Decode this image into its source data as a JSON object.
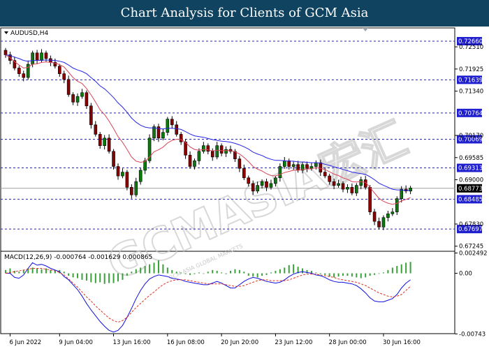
{
  "banner": {
    "title": "Chart Analysis for Clients of GCM Asia"
  },
  "watermark": {
    "text": "GCMASIA宏汇",
    "subtext": "GCM ASIA GLOBAL MARKETS"
  },
  "chart_data": [
    {
      "type": "candlestick",
      "symbol_label": "AUDUSD,H4",
      "ylim": [
        0.6711,
        0.7301
      ],
      "y_ticks": [
        "0.72510",
        "0.71925",
        "0.71340",
        "0.70170",
        "0.69585",
        "0.69000",
        "0.67830",
        "0.67245"
      ],
      "x_ticks": [
        "6 Jun 2022",
        "9 Jun 04:00",
        "13 Jun 16:00",
        "16 Jun 08:00",
        "20 Jun 20:00",
        "23 Jun 12:00",
        "28 Jun 00:00",
        "30 Jun 16:00"
      ],
      "levels": [
        {
          "value": 0.7266,
          "label": "0.72660"
        },
        {
          "value": 0.71639,
          "label": "0.71639"
        },
        {
          "value": 0.70764,
          "label": "0.70764"
        },
        {
          "value": 0.70069,
          "label": "0.70069"
        },
        {
          "value": 0.69313,
          "label": "0.69313"
        },
        {
          "value": 0.68485,
          "label": "0.68485"
        },
        {
          "value": 0.67697,
          "label": "0.67697"
        }
      ],
      "current_price": {
        "value": 0.68773,
        "label": "0.68773"
      },
      "closes": [
        0.723,
        0.7215,
        0.7195,
        0.718,
        0.717,
        0.7205,
        0.7235,
        0.7215,
        0.7235,
        0.722,
        0.721,
        0.72,
        0.718,
        0.7165,
        0.7125,
        0.7105,
        0.712,
        0.713,
        0.7095,
        0.7045,
        0.702,
        0.699,
        0.701,
        0.6975,
        0.6935,
        0.691,
        0.692,
        0.688,
        0.686,
        0.6895,
        0.6925,
        0.695,
        0.701,
        0.704,
        0.701,
        0.7025,
        0.706,
        0.7045,
        0.702,
        0.7,
        0.6965,
        0.6935,
        0.695,
        0.6975,
        0.699,
        0.6975,
        0.696,
        0.699,
        0.697,
        0.698,
        0.6975,
        0.6955,
        0.693,
        0.6905,
        0.689,
        0.687,
        0.6885,
        0.6895,
        0.688,
        0.689,
        0.6905,
        0.6935,
        0.695,
        0.6935,
        0.694,
        0.6925,
        0.694,
        0.693,
        0.6935,
        0.6945,
        0.692,
        0.691,
        0.6895,
        0.6885,
        0.689,
        0.6875,
        0.688,
        0.6865,
        0.6885,
        0.69,
        0.688,
        0.6815,
        0.679,
        0.6775,
        0.68,
        0.681,
        0.6815,
        0.685,
        0.6875,
        0.687,
        0.6878
      ],
      "ema_fast": [
        0.723,
        0.7222,
        0.7212,
        0.7203,
        0.7195,
        0.7197,
        0.7205,
        0.7206,
        0.721,
        0.7211,
        0.721,
        0.7208,
        0.7204,
        0.7198,
        0.7184,
        0.717,
        0.716,
        0.7154,
        0.7141,
        0.7124,
        0.7105,
        0.7085,
        0.7072,
        0.7055,
        0.7035,
        0.7014,
        0.6999,
        0.698,
        0.696,
        0.6949,
        0.6946,
        0.6948,
        0.696,
        0.6974,
        0.6979,
        0.6986,
        0.6997,
        0.7004,
        0.7007,
        0.7006,
        0.6999,
        0.6987,
        0.698,
        0.6978,
        0.698,
        0.6979,
        0.6976,
        0.6978,
        0.6977,
        0.6977,
        0.6977,
        0.6974,
        0.6968,
        0.6959,
        0.6948,
        0.6935,
        0.6928,
        0.6923,
        0.6916,
        0.6911,
        0.691,
        0.6914,
        0.6919,
        0.6922,
        0.6925,
        0.6925,
        0.6927,
        0.6928,
        0.6929,
        0.6932,
        0.693,
        0.6927,
        0.6921,
        0.6915,
        0.6911,
        0.6905,
        0.6901,
        0.6895,
        0.6894,
        0.6895,
        0.6893,
        0.688,
        0.6865,
        0.6851,
        0.6843,
        0.6838,
        0.6835,
        0.6838,
        0.6844,
        0.6848,
        0.6853
      ],
      "ema_slow": [
        0.723,
        0.7228,
        0.7224,
        0.722,
        0.7215,
        0.7213,
        0.7215,
        0.7215,
        0.7216,
        0.7216,
        0.7216,
        0.7215,
        0.7213,
        0.721,
        0.7203,
        0.7195,
        0.719,
        0.7186,
        0.718,
        0.717,
        0.716,
        0.7148,
        0.714,
        0.7129,
        0.7117,
        0.7103,
        0.7092,
        0.7078,
        0.7063,
        0.7052,
        0.7044,
        0.7039,
        0.7037,
        0.7037,
        0.7035,
        0.7034,
        0.7036,
        0.7036,
        0.7035,
        0.7033,
        0.7027,
        0.7021,
        0.7016,
        0.7014,
        0.7012,
        0.7009,
        0.7006,
        0.7004,
        0.7002,
        0.7001,
        0.6999,
        0.6996,
        0.6992,
        0.6987,
        0.6981,
        0.6973,
        0.6968,
        0.6964,
        0.6958,
        0.6954,
        0.6951,
        0.6951,
        0.695,
        0.6949,
        0.6949,
        0.6947,
        0.6947,
        0.6946,
        0.6945,
        0.6945,
        0.6944,
        0.6941,
        0.6938,
        0.6934,
        0.6931,
        0.6927,
        0.6924,
        0.692,
        0.6918,
        0.6916,
        0.6914,
        0.6908,
        0.69,
        0.6891,
        0.6885,
        0.688,
        0.6875,
        0.6873,
        0.6873,
        0.6872,
        0.6872
      ]
    },
    {
      "type": "macd",
      "label": "MACD(12,26,9) -0.000764 -0.001629 0.000865",
      "ylim": [
        -0.0074,
        0.0027
      ],
      "y_ticks": [
        {
          "value": 0.002492,
          "label": "0.002492"
        },
        {
          "value": 0.0,
          "label": "0.00"
        },
        {
          "value": -0.00743,
          "label": "-0.00743"
        }
      ],
      "macd": [
        0.0,
        0.0,
        -0.0005,
        -0.0006,
        -0.0002,
        0.0006,
        0.0013,
        0.001,
        0.0011,
        0.0009,
        0.0006,
        0.0004,
        0.0002,
        -0.0004,
        -0.0008,
        -0.0014,
        -0.002,
        -0.0028,
        -0.0037,
        -0.0045,
        -0.0052,
        -0.0059,
        -0.0065,
        -0.007,
        -0.0072,
        -0.007,
        -0.0064,
        -0.0054,
        -0.0043,
        -0.0031,
        -0.0021,
        -0.0013,
        -0.0007,
        -0.0004,
        -0.0002,
        -0.0003,
        -0.0004,
        -0.0006,
        -0.0007,
        -0.0008,
        -0.001,
        -0.0011,
        -0.0012,
        -0.0013,
        -0.0014,
        -0.0014,
        -0.0012,
        -0.001,
        -0.0012,
        -0.0015,
        -0.0018,
        -0.0018,
        -0.0014,
        -0.001,
        -0.0007,
        -0.0005,
        -0.0006,
        -0.0008,
        -0.001,
        -0.0011,
        -0.0012,
        -0.0011,
        -0.0008,
        -0.0004,
        -0.0001,
        0.0001,
        0.0002,
        0.0001,
        0.0,
        -0.0002,
        -0.0003,
        -0.0005,
        -0.0008,
        -0.001,
        -0.0011,
        -0.0011,
        -0.0012,
        -0.0013,
        -0.0015,
        -0.0019,
        -0.0024,
        -0.003,
        -0.0034,
        -0.0035,
        -0.0035,
        -0.0033,
        -0.0031,
        -0.0026,
        -0.0018,
        -0.0012,
        -0.0008
      ],
      "signal": [
        0.0,
        0.0001,
        0.0002,
        0.0003,
        0.0004,
        0.0005,
        0.0006,
        0.0006,
        0.0006,
        0.0005,
        0.0004,
        0.0003,
        0.0001,
        -0.0002,
        -0.0007,
        -0.0012,
        -0.0017,
        -0.0023,
        -0.0029,
        -0.0034,
        -0.004,
        -0.0045,
        -0.005,
        -0.0055,
        -0.0058,
        -0.006,
        -0.0058,
        -0.0054,
        -0.0048,
        -0.0042,
        -0.0037,
        -0.0032,
        -0.0027,
        -0.0023,
        -0.0018,
        -0.0014,
        -0.0011,
        -0.0009,
        -0.0008,
        -0.0008,
        -0.0008,
        -0.0009,
        -0.001,
        -0.0011,
        -0.0012,
        -0.0013,
        -0.0013,
        -0.0013,
        -0.0013,
        -0.0014,
        -0.0015,
        -0.0016,
        -0.0016,
        -0.0015,
        -0.0013,
        -0.0011,
        -0.0009,
        -0.0008,
        -0.0008,
        -0.0009,
        -0.0009,
        -0.0009,
        -0.0009,
        -0.0008,
        -0.0006,
        -0.0004,
        -0.0002,
        -0.0001,
        -0.0001,
        -0.0001,
        -0.0002,
        -0.0003,
        -0.0004,
        -0.0005,
        -0.0007,
        -0.0008,
        -0.0009,
        -0.001,
        -0.0011,
        -0.0013,
        -0.0015,
        -0.0018,
        -0.0021,
        -0.0024,
        -0.0026,
        -0.0028,
        -0.0029,
        -0.0028,
        -0.0026,
        -0.0021,
        -0.0016
      ],
      "histogram": [
        0.0004,
        0.0006,
        0.0003,
        0.0002,
        0.0004,
        0.0006,
        0.0007,
        0.0006,
        0.0005,
        0.0006,
        0.0004,
        0.0003,
        0.0004,
        0.0002,
        -0.0003,
        -0.0005,
        -0.0006,
        -0.0008,
        -0.0009,
        -0.0011,
        -0.0012,
        -0.0011,
        -0.0013,
        -0.0012,
        -0.0012,
        -0.001,
        -0.0008,
        -0.0003,
        0.0002,
        0.0005,
        0.0007,
        0.0009,
        0.0011,
        0.0013,
        0.0016,
        0.0011,
        0.0007,
        0.0004,
        0.0002,
        0.0001,
        -0.0001,
        -0.0002,
        -0.0001,
        0.0001,
        0.0,
        0.0002,
        0.0004,
        0.0003,
        0.0001,
        -0.0001,
        0.0003,
        0.0005,
        0.0004,
        0.0002,
        -0.0003,
        -0.0004,
        -0.0005,
        -0.0003,
        -0.0002,
        0.0001,
        0.0003,
        0.0005,
        0.0007,
        0.001,
        0.0011,
        0.0008,
        0.0006,
        0.0004,
        0.0003,
        0.0001,
        -0.0001,
        -0.0002,
        -0.0004,
        -0.0005,
        -0.0004,
        -0.0003,
        -0.0003,
        -0.0004,
        -0.0005,
        -0.0006,
        -0.0005,
        -0.0003,
        -0.0002,
        0.0,
        0.0001,
        0.0004,
        0.0007,
        0.0009,
        0.0011,
        0.0013,
        0.0014
      ]
    }
  ],
  "colors": {
    "bull": "#0a7a0a",
    "bear": "#8b0000",
    "ema_fast": "#d9465a",
    "ema_slow": "#2626e6",
    "level": "#1f1fd0",
    "macd": "#1010e0",
    "signal": "#e03020",
    "hist": "#3aa03a",
    "banner": "#0f4360"
  }
}
